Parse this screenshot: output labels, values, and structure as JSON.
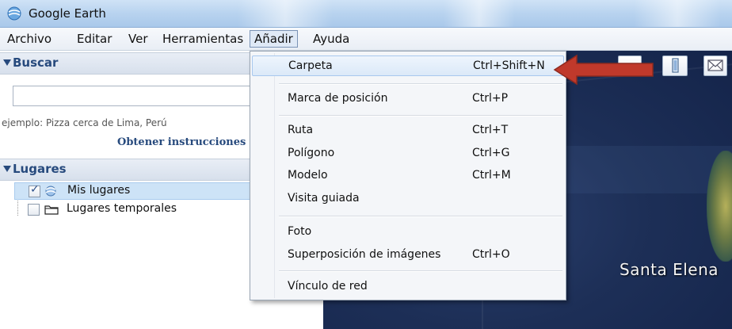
{
  "window": {
    "title": "Google Earth",
    "app_icon": "google-earth-icon"
  },
  "menubar": {
    "items": [
      {
        "label": "Archivo"
      },
      {
        "label": "Editar"
      },
      {
        "label": "Ver"
      },
      {
        "label": "Herramientas"
      },
      {
        "label": "Añadir"
      },
      {
        "label": "Ayuda"
      }
    ],
    "active": "Añadir"
  },
  "search": {
    "header": "Buscar",
    "input_value": "",
    "hint": "ejemplo: Pizza cerca de Lima, Perú",
    "directions_label": "Obtener instrucciones"
  },
  "places": {
    "header": "Lugares",
    "items": [
      {
        "label": "Mis lugares",
        "checked": true,
        "icon": "my-places-icon",
        "selected": true
      },
      {
        "label": "Lugares temporales",
        "checked": false,
        "icon": "folder-icon",
        "selected": false
      }
    ]
  },
  "add_menu": {
    "items": [
      {
        "label": "Carpeta",
        "shortcut": "Ctrl+Shift+N",
        "highlighted": true
      },
      {
        "label": "Marca de posición",
        "shortcut": "Ctrl+P"
      },
      {
        "label": "Ruta",
        "shortcut": "Ctrl+T"
      },
      {
        "label": "Polígono",
        "shortcut": "Ctrl+G"
      },
      {
        "label": "Modelo",
        "shortcut": "Ctrl+M"
      },
      {
        "label": "Visita guiada",
        "shortcut": ""
      },
      {
        "label": "Foto",
        "shortcut": ""
      },
      {
        "label": "Superposición de imágenes",
        "shortcut": "Ctrl+O"
      },
      {
        "label": "Vínculo de red",
        "shortcut": ""
      }
    ]
  },
  "map": {
    "place_label": "Santa Elena"
  },
  "colors": {
    "arrow": "#c0392b",
    "highlight": "#dbe9f8",
    "section_text": "#274a7d"
  }
}
